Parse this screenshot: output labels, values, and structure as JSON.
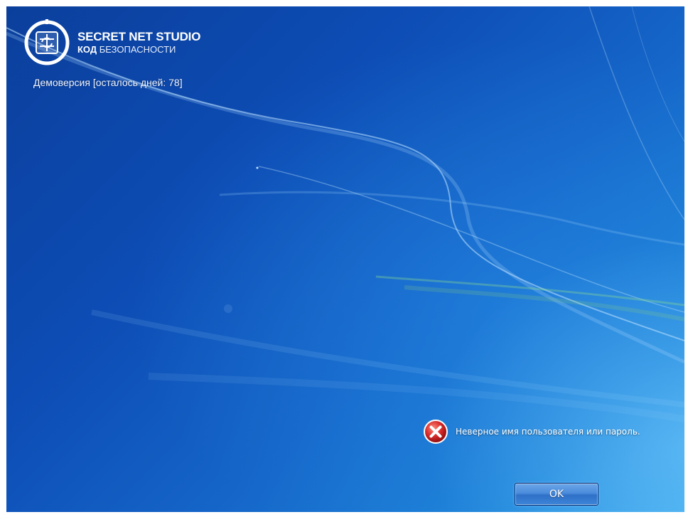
{
  "brand": {
    "title": "SECRET NET STUDIO",
    "subtitle_bold": "КОД",
    "subtitle_rest": "БЕЗОПАСНОСТИ",
    "logo_icon": "secret-net-logo-icon"
  },
  "demo_notice": "Демоверсия [осталось дней: 78]",
  "message": {
    "icon": "error-icon",
    "text": "Неверное имя пользователя или пароль."
  },
  "ok_button": {
    "label": "OK"
  },
  "colors": {
    "background_dark": "#0b3f9c",
    "background_light": "#3aa6ea",
    "error_red": "#d62a2a",
    "text": "#ffffff"
  }
}
